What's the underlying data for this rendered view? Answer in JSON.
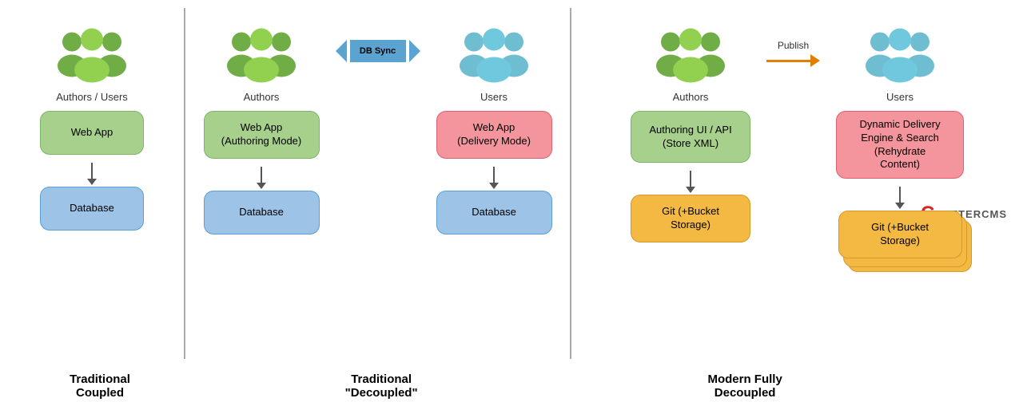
{
  "sections": [
    {
      "id": "traditional-coupled",
      "title": "Traditional\nCoupled",
      "people": [
        {
          "label": "Authors /\nUsers",
          "color": "green"
        }
      ],
      "boxes": [
        {
          "label": "Web App",
          "style": "green"
        },
        {
          "label": "Database",
          "style": "blue"
        }
      ]
    },
    {
      "id": "traditional-decoupled",
      "title": "Traditional\n\"Decoupled\"",
      "leftCol": {
        "people": {
          "label": "Authors",
          "color": "green"
        },
        "boxes": [
          {
            "label": "Web App\n(Authoring Mode)",
            "style": "green"
          },
          {
            "label": "Database",
            "style": "blue"
          }
        ]
      },
      "rightCol": {
        "people": {
          "label": "Users",
          "color": "teal"
        },
        "boxes": [
          {
            "label": "Web App\n(Delivery Mode)",
            "style": "red"
          },
          {
            "label": "Database",
            "style": "blue"
          }
        ]
      },
      "syncLabel": "DB Sync"
    },
    {
      "id": "modern-fully-decoupled",
      "title": "Modern Fully\nDecoupled",
      "leftCol": {
        "people": {
          "label": "Authors",
          "color": "green"
        },
        "boxes": [
          {
            "label": "Authoring UI / API\n(Store XML)",
            "style": "green"
          },
          {
            "label": "Git (+Bucket\nStorage)",
            "style": "orange"
          }
        ]
      },
      "rightCol": {
        "people": {
          "label": "Users",
          "color": "teal"
        },
        "boxes": [
          {
            "label": "Dynamic Delivery\nEngine & Search\n(Rehydrate\nContent)",
            "style": "red"
          },
          {
            "label": "Git (+Bucket\nStorage)",
            "style": "orange",
            "stacked": true
          }
        ]
      },
      "publishLabel": "Publish"
    }
  ],
  "logo": {
    "brand_c": "C",
    "brand_rest": "RAFTERCMS"
  }
}
